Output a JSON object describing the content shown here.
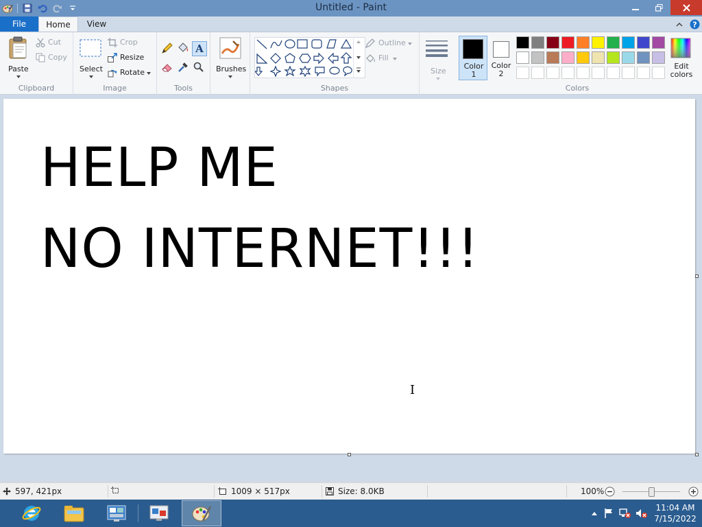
{
  "window": {
    "title": "Untitled - Paint"
  },
  "tabs": {
    "file": "File",
    "home": "Home",
    "view": "View"
  },
  "ribbon": {
    "clipboard": {
      "label": "Clipboard",
      "paste": "Paste",
      "cut": "Cut",
      "copy": "Copy"
    },
    "image": {
      "label": "Image",
      "select": "Select",
      "crop": "Crop",
      "resize": "Resize",
      "rotate": "Rotate"
    },
    "tools": {
      "label": "Tools"
    },
    "brushes": {
      "label": "Brushes"
    },
    "shapes": {
      "label": "Shapes",
      "outline": "Outline",
      "fill": "Fill"
    },
    "size": {
      "label": "Size"
    },
    "colors": {
      "label": "Colors",
      "color1": "Color 1",
      "color2": "Color 2",
      "edit": "Edit colors",
      "color1_value": "#000000",
      "color2_value": "#ffffff",
      "palette_row1": [
        "#000000",
        "#7f7f7f",
        "#880015",
        "#ed1c24",
        "#ff7f27",
        "#fff200",
        "#22b14c",
        "#00a2e8",
        "#3f48cc",
        "#a349a4"
      ],
      "palette_row2": [
        "#ffffff",
        "#c3c3c3",
        "#b97a57",
        "#ffaec9",
        "#ffc90e",
        "#efe4b0",
        "#b5e61d",
        "#99d9ea",
        "#7092be",
        "#c8bfe7"
      ]
    }
  },
  "canvas": {
    "line1": "HELP ME",
    "line2": "NO INTERNET!!!"
  },
  "status": {
    "cursor_pos": "597, 421px",
    "canvas_dims": "1009 × 517px",
    "file_size": "Size: 8.0KB",
    "zoom": "100%"
  },
  "taskbar": {
    "time": "11:04 AM",
    "date": "7/15/2022"
  }
}
